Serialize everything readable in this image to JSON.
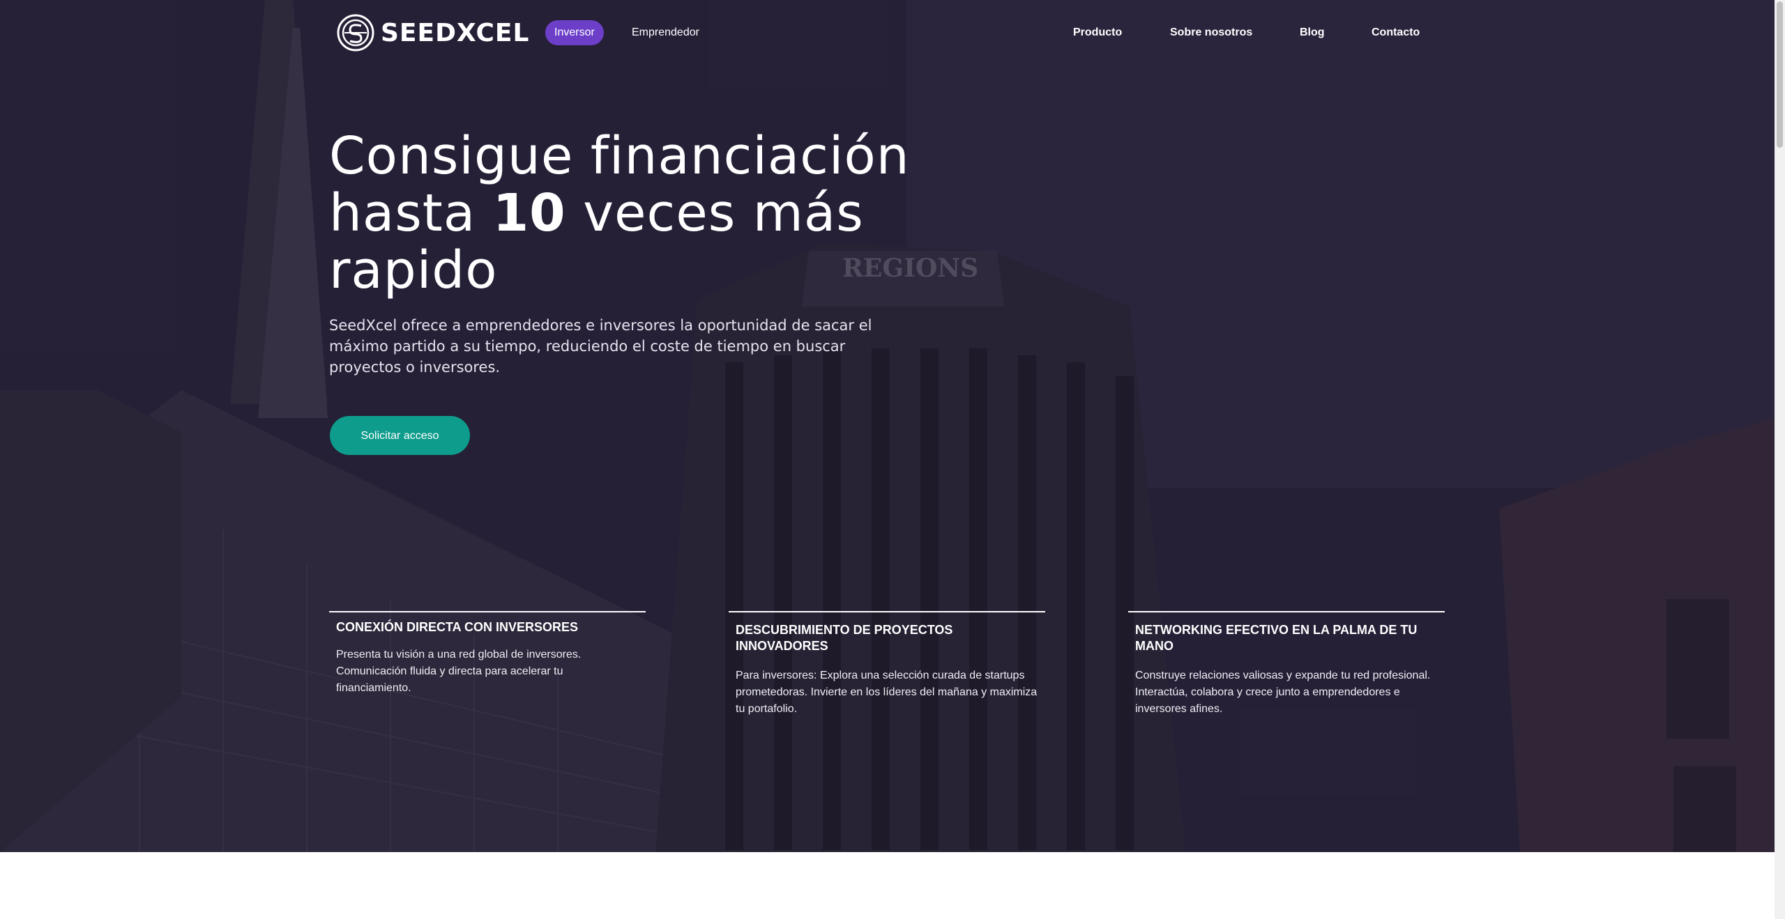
{
  "brand": {
    "name": "SEEDXCEL"
  },
  "nav": {
    "roles": [
      {
        "label": "Inversor",
        "active": true
      },
      {
        "label": "Emprendedor",
        "active": false
      }
    ],
    "links": [
      "Producto",
      "Sobre nosotros",
      "Blog",
      "Contacto"
    ]
  },
  "hero": {
    "headline_part1": "Consigue financiación hasta ",
    "headline_bold": "10",
    "headline_part2": " veces más rapido",
    "subtext": "SeedXcel ofrece a emprendedores e inversores la oportunidad de sacar el máximo partido a su tiempo, reduciendo el coste de tiempo en buscar proyectos o inversores.",
    "cta_label": "Solicitar acceso"
  },
  "features": [
    {
      "title": "CONEXIÓN DIRECTA CON INVERSORES",
      "text": "Presenta tu visión a una red global de inversores. Comunicación fluida y directa para acelerar tu financiamiento."
    },
    {
      "title": "DESCUBRIMIENTO DE PROYECTOS INNOVADORES",
      "text": "Para inversores: Explora una selección curada de startups prometedoras. Invierte en los líderes del mañana y maximiza tu portafolio."
    },
    {
      "title": "NETWORKING EFECTIVO EN LA PALMA DE TU MANO",
      "text": "Construye relaciones valiosas y expande tu red profesional. Interactúa, colabora y crece junto a emprendedores e inversores afines."
    }
  ],
  "colors": {
    "accent_purple": "#6d3fc9",
    "cta_teal": "#0e9c8c",
    "hero_dark": "#2a2438"
  }
}
